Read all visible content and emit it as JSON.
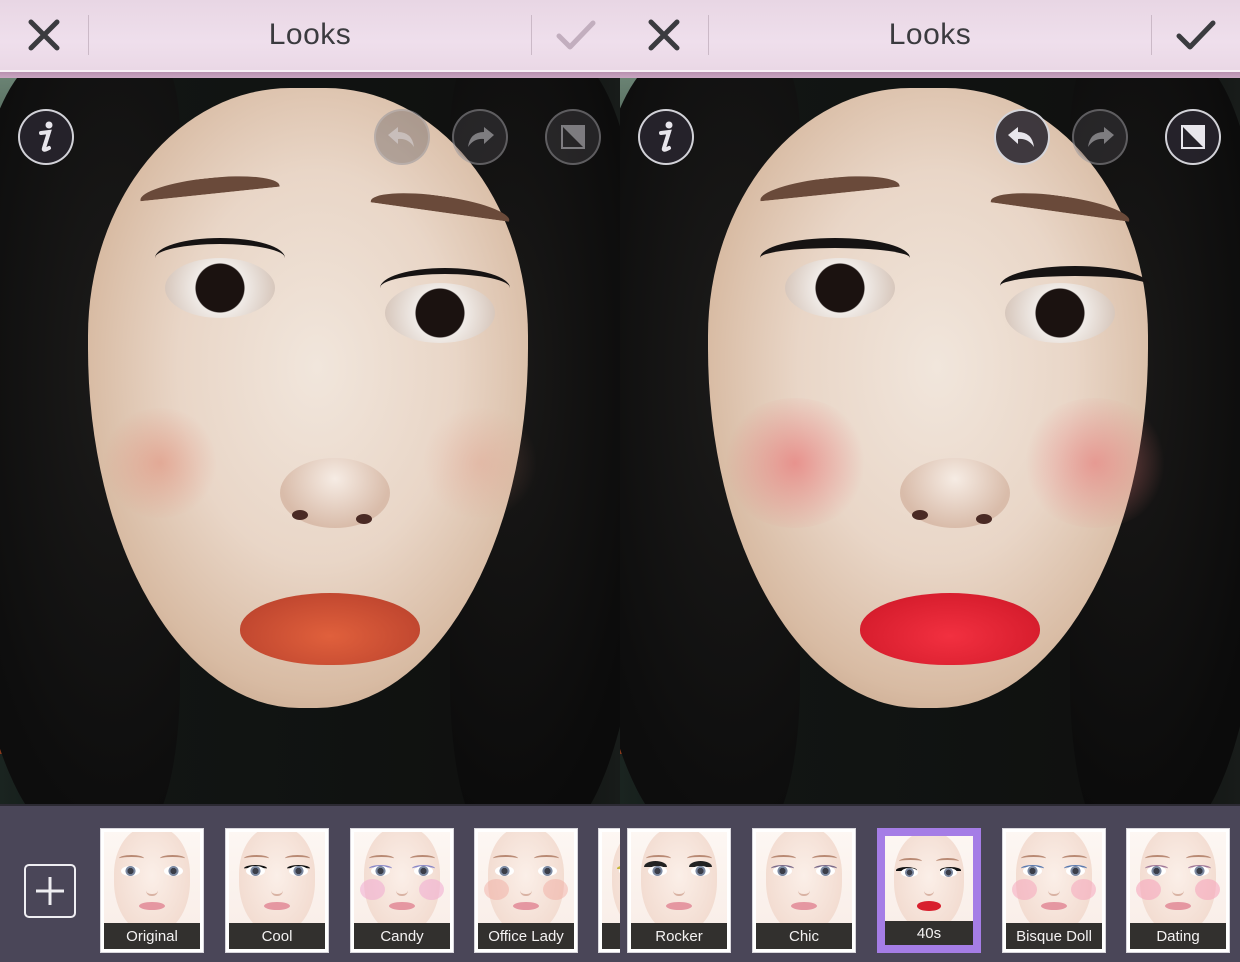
{
  "screens": [
    {
      "id": "before",
      "header": {
        "title": "Looks",
        "cancel_icon": "close-icon",
        "confirm_icon": "checkmark-icon",
        "confirm_enabled": false
      },
      "tools": {
        "info": {
          "icon": "info-icon",
          "enabled": true
        },
        "undo": {
          "icon": "undo-arrow-icon",
          "enabled": false
        },
        "redo": {
          "icon": "redo-arrow-icon",
          "enabled": false
        },
        "compare": {
          "icon": "compare-split-icon",
          "enabled": false
        }
      },
      "photo": {
        "description": "Selfie of woman with dark hair, orange-red lipstick, no look applied",
        "lip_color": "#c94a32"
      },
      "add_button_icon": "plus-icon",
      "looks": [
        {
          "label": "Original",
          "selected": false
        },
        {
          "label": "Cool",
          "selected": false
        },
        {
          "label": "Candy",
          "selected": false
        },
        {
          "label": "Office Lady",
          "selected": false
        },
        {
          "label": "",
          "selected": false
        }
      ]
    },
    {
      "id": "after",
      "header": {
        "title": "Looks",
        "cancel_icon": "close-icon",
        "confirm_icon": "checkmark-icon",
        "confirm_enabled": true
      },
      "tools": {
        "info": {
          "icon": "info-icon",
          "enabled": true
        },
        "undo": {
          "icon": "undo-arrow-icon",
          "enabled": true
        },
        "redo": {
          "icon": "redo-arrow-icon",
          "enabled": false
        },
        "compare": {
          "icon": "compare-split-icon",
          "enabled": true
        }
      },
      "photo": {
        "description": "Same selfie with 40s look applied: bold red lips, winged eyeliner, blush",
        "lip_color": "#d81e2e"
      },
      "looks": [
        {
          "label": "Rocker",
          "selected": false
        },
        {
          "label": "Chic",
          "selected": false
        },
        {
          "label": "40s",
          "selected": true
        },
        {
          "label": "Bisque Doll",
          "selected": false
        },
        {
          "label": "Dating",
          "selected": false
        }
      ]
    }
  ],
  "colors": {
    "header_bg": "#efdfec",
    "strip_bg": "#4a4658",
    "selected_border": "#a57de6",
    "icon_dark": "#3b3b3f",
    "icon_disabled": "#c2aebe"
  }
}
